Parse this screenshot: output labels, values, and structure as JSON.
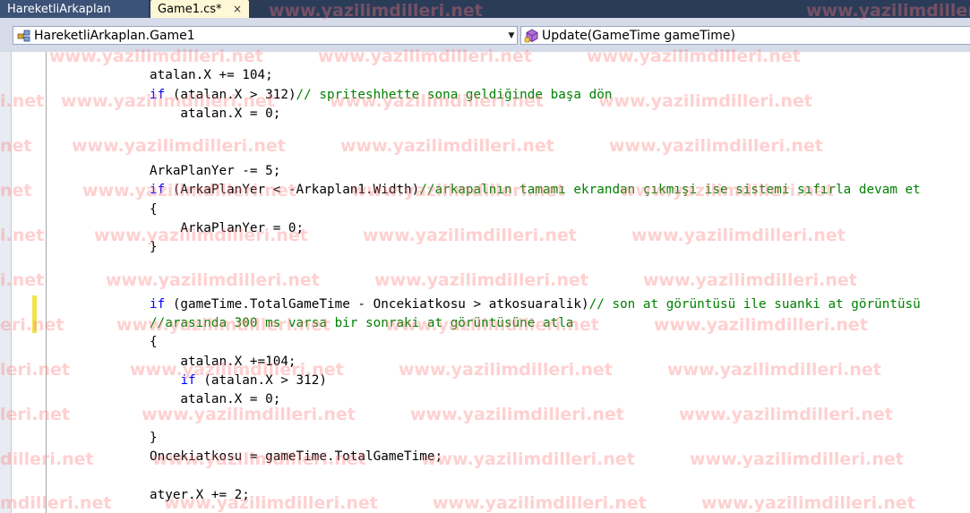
{
  "tabs": [
    {
      "label": "HareketliArkaplan",
      "active": false
    },
    {
      "label": "Game1.cs*",
      "active": true,
      "close": "×"
    }
  ],
  "navbar": {
    "class_combo": "HareketliArkaplan.Game1",
    "member_combo": "Update(GameTime gameTime)"
  },
  "watermark": "www.yazilimdilleri.net",
  "watermark_fragments": {
    "net": "net",
    "i_net": "i.net",
    "eri_net": "eri.net",
    "leri_net": "leri.net",
    "dilleri_net": "dilleri.net",
    "mdilleri_net": "mdilleri.net"
  },
  "code": {
    "l1": [
      "atalan.X += 104;"
    ],
    "l2_kw": "if",
    "l2_code": " (atalan.X > 312)",
    "l2_cm": "// spriteshhette sona geldiğinde başa dön",
    "l3": "    atalan.X = 0;",
    "l5": "ArkaPlanYer -= 5;",
    "l6_kw": "if",
    "l6_code": " (ArkaPlanYer < -Arkaplan1.Width)",
    "l6_cm": "//arkapalnın tamamı ekrandan çıkmışi ise sistemi sıfırla devam et",
    "l7": "{",
    "l8": "    ArkaPlanYer = 0;",
    "l9": "}",
    "l12_kw": "if",
    "l12_code": " (gameTime.TotalGameTime - Oncekiatkosu > atkosuaralik)",
    "l12_cm": "// son at görüntüsü ile suanki at görüntüsü",
    "l13_cm": "//arasında 300 ms varsa bir sonraki at görüntüsüne atla",
    "l14": "{",
    "l15": "    atalan.X +=104;",
    "l16_indent": "    ",
    "l16_kw": "if",
    "l16_code": " (atalan.X > 312)",
    "l17": "    atalan.X = 0;",
    "l19": "}",
    "l20": "Oncekiatkosu = gameTime.TotalGameTime;",
    "l22": "atyer.X += 2;"
  },
  "colors": {
    "keyword": "#0000ff",
    "comment": "#008000",
    "tab_strip": "#2b3c59",
    "active_tab": "#fff8d6",
    "change_marker": "#f2e34a"
  },
  "icons": [
    "class-icon",
    "method-icon",
    "dropdown-arrow-icon",
    "close-icon"
  ]
}
